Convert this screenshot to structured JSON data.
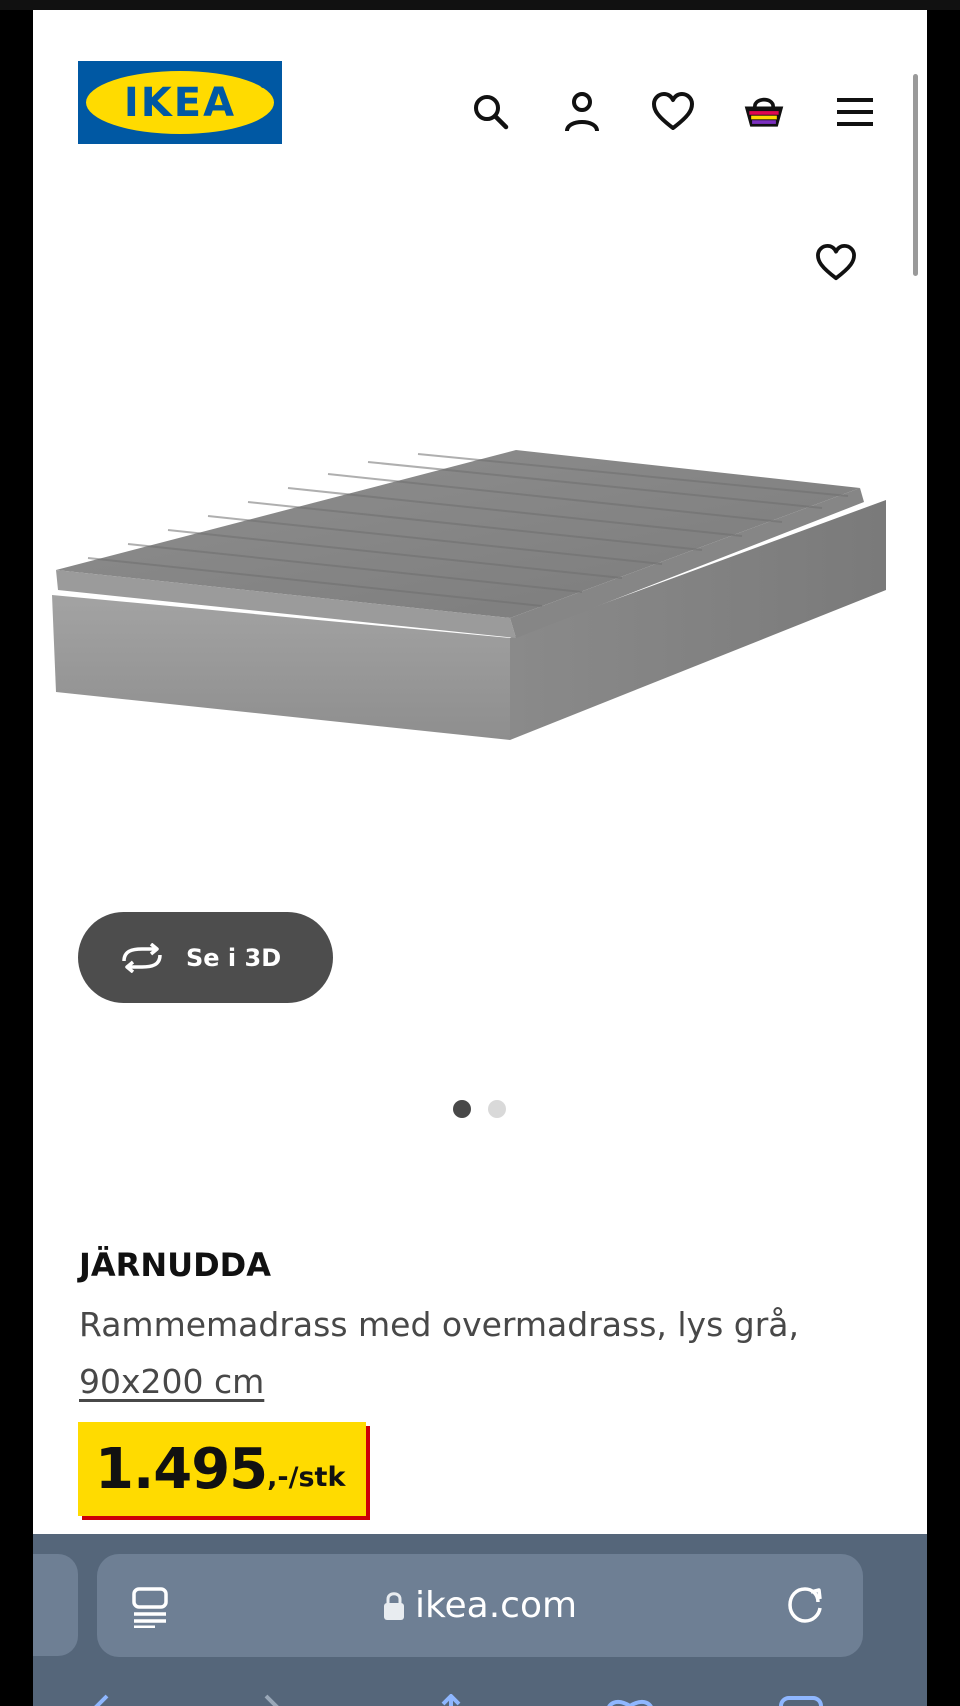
{
  "header": {
    "logo_text": "IKEA",
    "icons": [
      "search-icon",
      "account-icon",
      "wishlist-icon",
      "cart-icon",
      "menu-icon"
    ]
  },
  "gallery": {
    "view_3d_label": "Se i 3D",
    "dots": 2,
    "active_dot": 0
  },
  "product": {
    "name": "JÄRNUDDA",
    "description": "Rammemadrass med overmadrass, lys grå,",
    "size": "90x200 cm",
    "price_main": "1.495",
    "price_suffix": ",-/stk"
  },
  "browser": {
    "url": "ikea.com"
  },
  "colors": {
    "ikea_blue": "#0058a3",
    "ikea_yellow": "#ffdb00",
    "price_red": "#cc0008",
    "button_dark": "#4d4d4d"
  }
}
